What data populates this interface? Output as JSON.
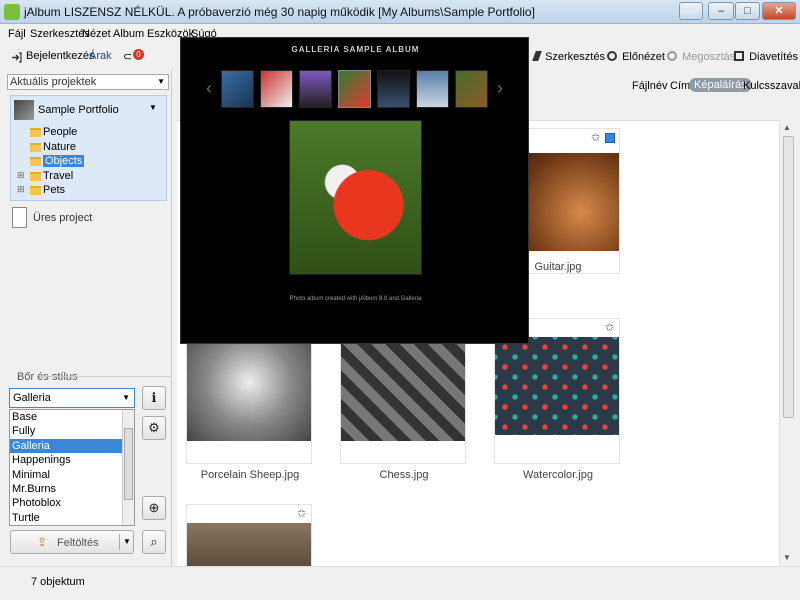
{
  "window": {
    "title": "jAlbum LISZENSZ NÉLKÜL. A próbaverzió még 30 napig működik [My Albums\\Sample Portfolio]",
    "buttons": {
      "minimize": "–",
      "maximize": "□",
      "close": "✕"
    }
  },
  "menu": [
    "Fájl",
    "Szerkesztés",
    "Nézet",
    "Album",
    "Eszközök",
    "Súgó"
  ],
  "left_toolbar": {
    "login": "Bejelentkezés",
    "prices": "Árak",
    "badge": "0"
  },
  "project_dropdown": {
    "value": "Aktuális projektek"
  },
  "tree": {
    "root": "Sample Portfolio",
    "items": [
      {
        "label": "People",
        "selected": false,
        "expander": ""
      },
      {
        "label": "Nature",
        "selected": false,
        "expander": ""
      },
      {
        "label": "Objects",
        "selected": true,
        "expander": ""
      },
      {
        "label": "Travel",
        "selected": false,
        "expander": "⊞"
      },
      {
        "label": "Pets",
        "selected": false,
        "expander": "⊞"
      }
    ]
  },
  "empty_project": "Üres project",
  "skin": {
    "title": "Bőr és stílus",
    "selected": "Galleria",
    "options": [
      "Base",
      "Fully",
      "Galleria",
      "Happenings",
      "Minimal",
      "Mr.Burns",
      "Photoblox",
      "Turtle"
    ]
  },
  "upload": {
    "label": "Feltöltés"
  },
  "right_toolbar": {
    "edit": "Szerkesztés",
    "preview": "Előnézet",
    "share": "Megosztás",
    "slideshow": "Diavetítés"
  },
  "sort": {
    "items": [
      "Fájlnév",
      "Cím",
      "Képaláírás",
      "Kulcsszavak"
    ],
    "active_index": 2
  },
  "grid": {
    "items": [
      {
        "name": "Guitar.jpg"
      },
      {
        "name": "Porcelain Sheep.jpg"
      },
      {
        "name": "Chess.jpg"
      },
      {
        "name": "Watercolor.jpg"
      },
      {
        "name": ""
      }
    ]
  },
  "overlay": {
    "title": "GALLERIA SAMPLE ALBUM",
    "footer": "Photo album created with jAlbum 8.8 and Galleria",
    "nav_prev": "‹",
    "nav_next": "›"
  },
  "status": {
    "text": "7 objektum"
  },
  "colors": {
    "accent": "#3b86d6",
    "selection": "#3b86d6",
    "tree_bg": "#dde9f6"
  }
}
